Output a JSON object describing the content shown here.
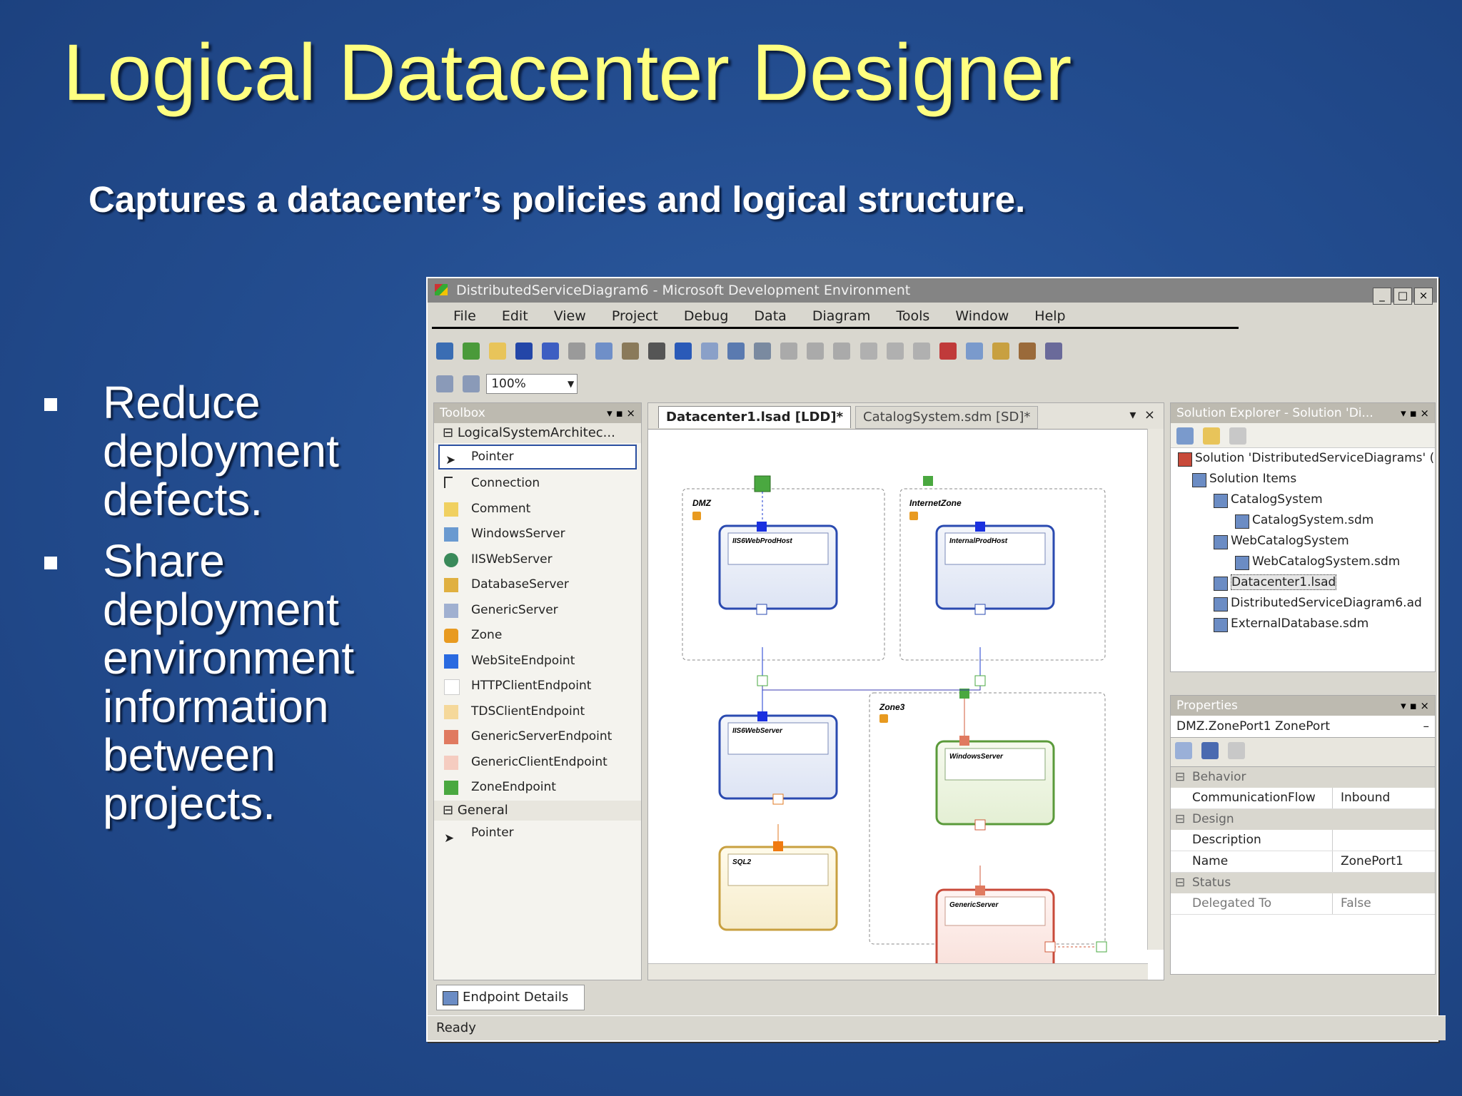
{
  "slide": {
    "title": "Logical Datacenter Designer",
    "subtitle": "Captures a datacenter’s policies and logical structure.",
    "bullets": [
      "Reduce deployment defects.",
      "Share deployment environment information between projects."
    ]
  },
  "ide": {
    "window_title": "DistributedServiceDiagram6 - Microsoft Development Environment",
    "menu": [
      "File",
      "Edit",
      "View",
      "Project",
      "Debug",
      "Data",
      "Diagram",
      "Tools",
      "Window",
      "Help"
    ],
    "zoom": "100%",
    "toolbox": {
      "title": "Toolbox",
      "group1": "LogicalSystemArchitec...",
      "items": [
        "Pointer",
        "Connection",
        "Comment",
        "WindowsServer",
        "IISWebServer",
        "DatabaseServer",
        "GenericServer",
        "Zone",
        "WebSiteEndpoint",
        "HTTPClientEndpoint",
        "TDSClientEndpoint",
        "GenericServerEndpoint",
        "GenericClientEndpoint",
        "ZoneEndpoint"
      ],
      "group2": "General",
      "general_items": [
        "Pointer"
      ]
    },
    "designer": {
      "tab_active": "Datacenter1.lsad [LDD]*",
      "tab_inactive": "CatalogSystem.sdm [SD]*",
      "zones": [
        "DMZ",
        "InternetZone",
        "Zone3"
      ],
      "servers": [
        "IIS6WebProdHost",
        "InternalProdHost",
        "IIS6WebServer",
        "SQL2",
        "WindowsServer",
        "GenericServer"
      ]
    },
    "solution_explorer": {
      "title": "Solution Explorer - Solution 'Di...",
      "nodes": [
        "Solution 'DistributedServiceDiagrams' (",
        "Solution Items",
        "CatalogSystem",
        "CatalogSystem.sdm",
        "WebCatalogSystem",
        "WebCatalogSystem.sdm",
        "Datacenter1.lsad",
        "DistributedServiceDiagram6.ad",
        "ExternalDatabase.sdm"
      ]
    },
    "properties": {
      "title": "Properties",
      "object": "DMZ.ZonePort1  ZonePort",
      "categories": [
        "Behavior",
        "Design",
        "Status"
      ],
      "rows": [
        {
          "key": "CommunicationFlow",
          "value": "Inbound"
        },
        {
          "key": "Description",
          "value": ""
        },
        {
          "key": "Name",
          "value": "ZonePort1"
        },
        {
          "key": "Delegated To",
          "value": "False"
        }
      ]
    },
    "bottom_tab": "Endpoint Details",
    "status": "Ready"
  }
}
